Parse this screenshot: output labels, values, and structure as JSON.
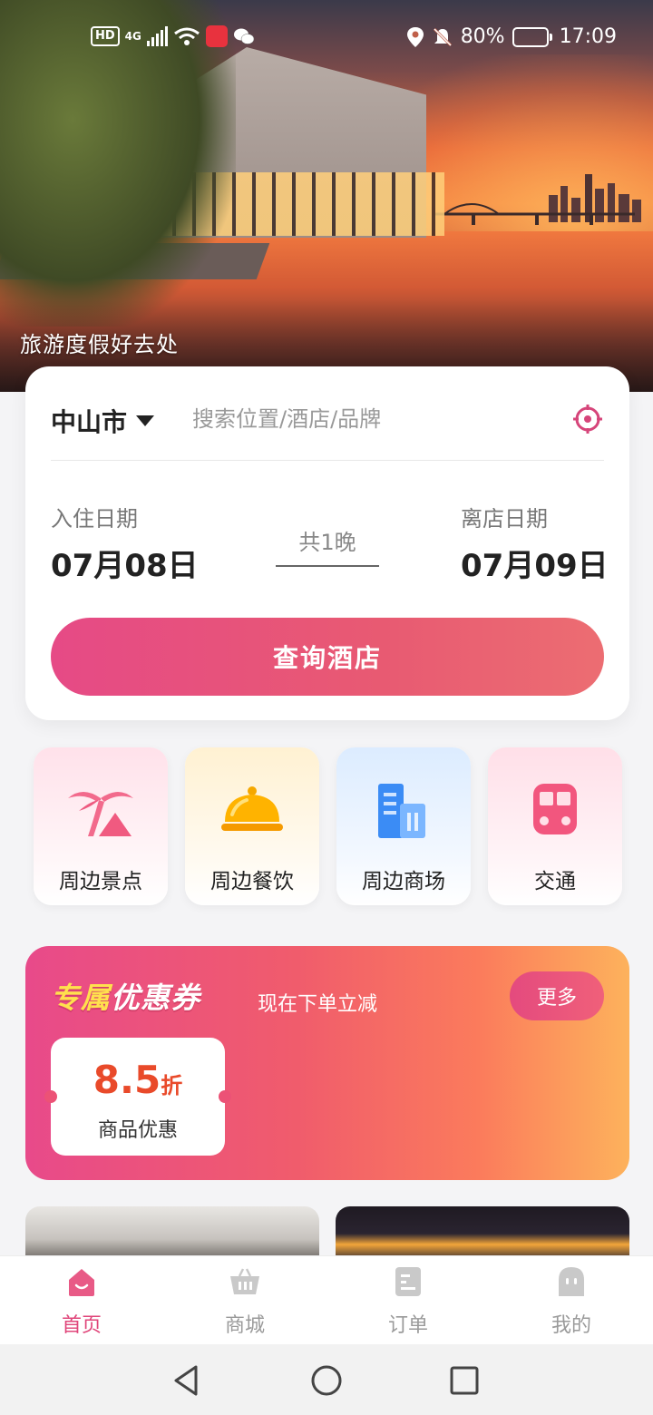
{
  "status_bar": {
    "hd": "HD",
    "network": "4G",
    "battery": "80%",
    "battery_level": 0.8,
    "time": "17:09"
  },
  "hero": {
    "caption": "旅游度假好去处"
  },
  "search": {
    "city": "中山市",
    "placeholder": "搜索位置/酒店/品牌",
    "checkin_label": "入住日期",
    "checkin_date": "07月08日",
    "nights": "共1晚",
    "checkout_label": "离店日期",
    "checkout_date": "07月09日",
    "button": "查询酒店"
  },
  "categories": [
    {
      "label": "周边景点",
      "icon": "palm-tree-icon"
    },
    {
      "label": "周边餐饮",
      "icon": "food-cloche-icon"
    },
    {
      "label": "周边商场",
      "icon": "building-icon"
    },
    {
      "label": "交通",
      "icon": "train-icon"
    }
  ],
  "coupon": {
    "title_a": "专属",
    "title_b": "优惠券",
    "subtitle": "现在下单立减",
    "more": "更多",
    "value": "8.5",
    "unit": "折",
    "desc": "商品优惠"
  },
  "tabs": [
    {
      "label": "首页",
      "icon": "home-icon",
      "active": true
    },
    {
      "label": "商城",
      "icon": "basket-icon",
      "active": false
    },
    {
      "label": "订单",
      "icon": "order-icon",
      "active": false
    },
    {
      "label": "我的",
      "icon": "profile-icon",
      "active": false
    }
  ],
  "colors": {
    "accent": "#e0457a",
    "button_start": "#e64a86",
    "button_end": "#ec6d72",
    "coupon_title": "#ffe14d"
  }
}
